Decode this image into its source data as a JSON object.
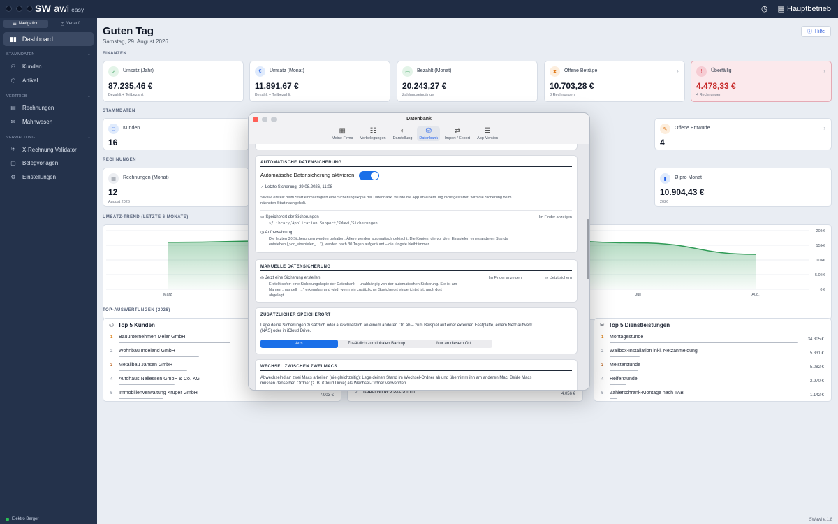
{
  "app": {
    "logo_sw": "SW",
    "logo_awi": "awi",
    "logo_edition": "easy",
    "company": "Hauptbetrieb",
    "version": "SWawi e.1.8"
  },
  "sidebar": {
    "segment": {
      "navigation": "Navigation",
      "history": "Verlauf"
    },
    "active_item": "Dashboard",
    "sections": [
      {
        "title": "STAMMDATEN",
        "items": [
          "Kunden",
          "Artikel"
        ]
      },
      {
        "title": "VERTRIEB",
        "items": [
          "Rechnungen",
          "Mahnwesen"
        ]
      },
      {
        "title": "VERWALTUNG",
        "items": [
          "X-Rechnung Validator",
          "Belegvorlagen",
          "Einstellungen"
        ]
      }
    ],
    "status": "Elektro Berger"
  },
  "header": {
    "title": "Guten Tag",
    "date": "Samstag, 29. August 2026",
    "help": "Hilfe"
  },
  "finanzen": {
    "title": "FINANZEN",
    "cards": [
      {
        "label": "Umsatz (Jahr)",
        "value": "87.235,46 €",
        "sub": "Bezahlt + Teilbezahlt",
        "color": "#2e9a55"
      },
      {
        "label": "Umsatz (Monat)",
        "value": "11.891,67 €",
        "sub": "Bezahlt + Teilbezahlt",
        "color": "#2563eb"
      },
      {
        "label": "Bezahlt (Monat)",
        "value": "20.243,27 €",
        "sub": "Zahlungseingänge",
        "color": "#2e9a55"
      },
      {
        "label": "Offene Beträge",
        "value": "10.703,28 €",
        "sub": "8 Rechnungen",
        "color": "#e07b1d"
      },
      {
        "label": "Überfällig",
        "value": "4.478,33 €",
        "sub": "4 Rechnungen",
        "color": "#d32f3a"
      }
    ]
  },
  "stammdaten": {
    "title": "STAMMDATEN",
    "kunden_label": "Kunden",
    "kunden_value": "16",
    "entwuerfe_label": "Offene Entwürfe",
    "entwuerfe_value": "4"
  },
  "rechnungen": {
    "title": "RECHNUNGEN",
    "monat_label": "Rechnungen (Monat)",
    "monat_value": "12",
    "monat_sub": "August 2026",
    "pro_monat_label": "Ø pro Monat",
    "pro_monat_value": "10.904,43 €",
    "pro_monat_sub": "2026"
  },
  "trend": {
    "title": "UMSATZ-TREND (LETZTE 6 MONATE)",
    "yticks": [
      "20 k€",
      "15 k€",
      "10 k€",
      "5.0 k€",
      "0 €"
    ],
    "xticks": [
      "März",
      "Juli",
      "Aug."
    ]
  },
  "chart_data": {
    "type": "area",
    "x": [
      "März",
      "Apr.",
      "Mai",
      "Juni",
      "Juli",
      "Aug."
    ],
    "values": [
      16000,
      16500,
      16800,
      17000,
      15800,
      11892
    ],
    "ylim": [
      0,
      20000
    ]
  },
  "top": {
    "title": "TOP-AUSWERTUNGEN (2026)",
    "kunden": {
      "title": "Top 5 Kunden",
      "rows": [
        {
          "rank": "1",
          "name": "Bauunternehmen Meier GmbH",
          "value": "",
          "share": 1.0
        },
        {
          "rank": "2",
          "name": "Wohnbau Indeland GmbH",
          "value": "",
          "share": 0.72
        },
        {
          "rank": "3",
          "name": "Metallbau Jansen GmbH",
          "value": "",
          "share": 0.61
        },
        {
          "rank": "4",
          "name": "Autohaus Nellessen GmbH & Co. KG",
          "value": "",
          "share": 0.5
        },
        {
          "rank": "5",
          "name": "Immobilienverwaltung Krüger GmbH",
          "value": "7.903 €",
          "share": 0.4
        }
      ]
    },
    "artikel": {
      "row5_name": "Kabel NYM-J 5x2,5 mm²",
      "row5_value": "4.056 €"
    },
    "dienst": {
      "title": "Top 5 Dienstleistungen",
      "rows": [
        {
          "rank": "1",
          "name": "Montagestunde",
          "value": "34.305 €",
          "share": 1.0
        },
        {
          "rank": "2",
          "name": "Wallbox-Installation inkl. Netzanmeldung",
          "value": "5.331 €",
          "share": 0.16
        },
        {
          "rank": "3",
          "name": "Meisterstunde",
          "value": "5.082 €",
          "share": 0.15
        },
        {
          "rank": "4",
          "name": "Helferstunde",
          "value": "2.970 €",
          "share": 0.09
        },
        {
          "rank": "5",
          "name": "Zählerschrank-Montage nach TAB",
          "value": "1.142 €",
          "share": 0.04
        }
      ]
    }
  },
  "modal": {
    "title": "Datenbank",
    "tabs": [
      {
        "label": "Meine Firma",
        "icon": "building-icon"
      },
      {
        "label": "Vorbelegungen",
        "icon": "list-icon"
      },
      {
        "label": "Darstellung",
        "icon": "palette-icon"
      },
      {
        "label": "Datenbank",
        "icon": "database-icon"
      },
      {
        "label": "Import / Export",
        "icon": "exchange-icon"
      },
      {
        "label": "App-Version",
        "icon": "sliders-icon"
      }
    ],
    "auto": {
      "title": "AUTOMATISCHE DATENSICHERUNG",
      "toggle_label": "Automatische Datensicherung aktivieren",
      "last": "Letzte Sicherung: 29.08.2026, 11:08",
      "desc1": "SWawi erstellt beim Start einmal täglich eine Sicherungskopie der Datenbank. Wurde die App an einem Tag nicht gestartet, wird die Sicherung beim",
      "desc2": "nächsten Start nachgeholt.",
      "loc_label": "Speicherort der Sicherungen",
      "loc_path": "~/Library/Application Support/SWawi/Sicherungen",
      "finder": "Im Finder anzeigen",
      "ret_label": "Aufbewahrung",
      "ret1": "Die letzten 30 Sicherungen werden behalten. Ältere werden automatisch gelöscht. Die Kopien, die vor dem Einspielen eines anderen Stands",
      "ret2": "entstehen („vor_einspielen_…\"), werden nach 30 Tagen aufgeräumt – die jüngste bleibt immer."
    },
    "manual": {
      "title": "MANUELLE DATENSICHERUNG",
      "create": "Jetzt eine Sicherung erstellen",
      "d1": "Erstellt sofort eine Sicherungskopie der Datenbank – unabhängig von der automatischen Sicherung. Sie ist am",
      "d2": "Namen „manuell_…\" erkennbar und wird, wenn ein zusätzlicher Speicherort eingerichtet ist, auch dort",
      "d3": "abgelegt.",
      "finder": "Im Finder anzeigen",
      "now": "Jetzt sichern"
    },
    "extra": {
      "title": "ZUSÄTZLICHER SPEICHERORT",
      "d1": "Lege deine Sicherungen zusätzlich oder ausschließlich an einem anderen Ort ab – zum Beispiel auf einer externen Festplatte, einem Netzlaufwerk",
      "d2": "(NAS) oder in iCloud Drive.",
      "options": [
        "Aus",
        "Zusätzlich zum lokalen Backup",
        "Nur an diesem Ort"
      ]
    },
    "swap": {
      "title": "WECHSEL ZWISCHEN ZWEI MACS",
      "d1": "Abwechselnd an zwei Macs arbeiten (nie gleichzeitig): Lege deinen Stand im Wechsel-Ordner ab und übernimm ihn am anderen Mac. Beide Macs",
      "d2": "müssen denselben Ordner (z. B. iCloud Drive) als Wechsel-Ordner verwenden."
    }
  }
}
